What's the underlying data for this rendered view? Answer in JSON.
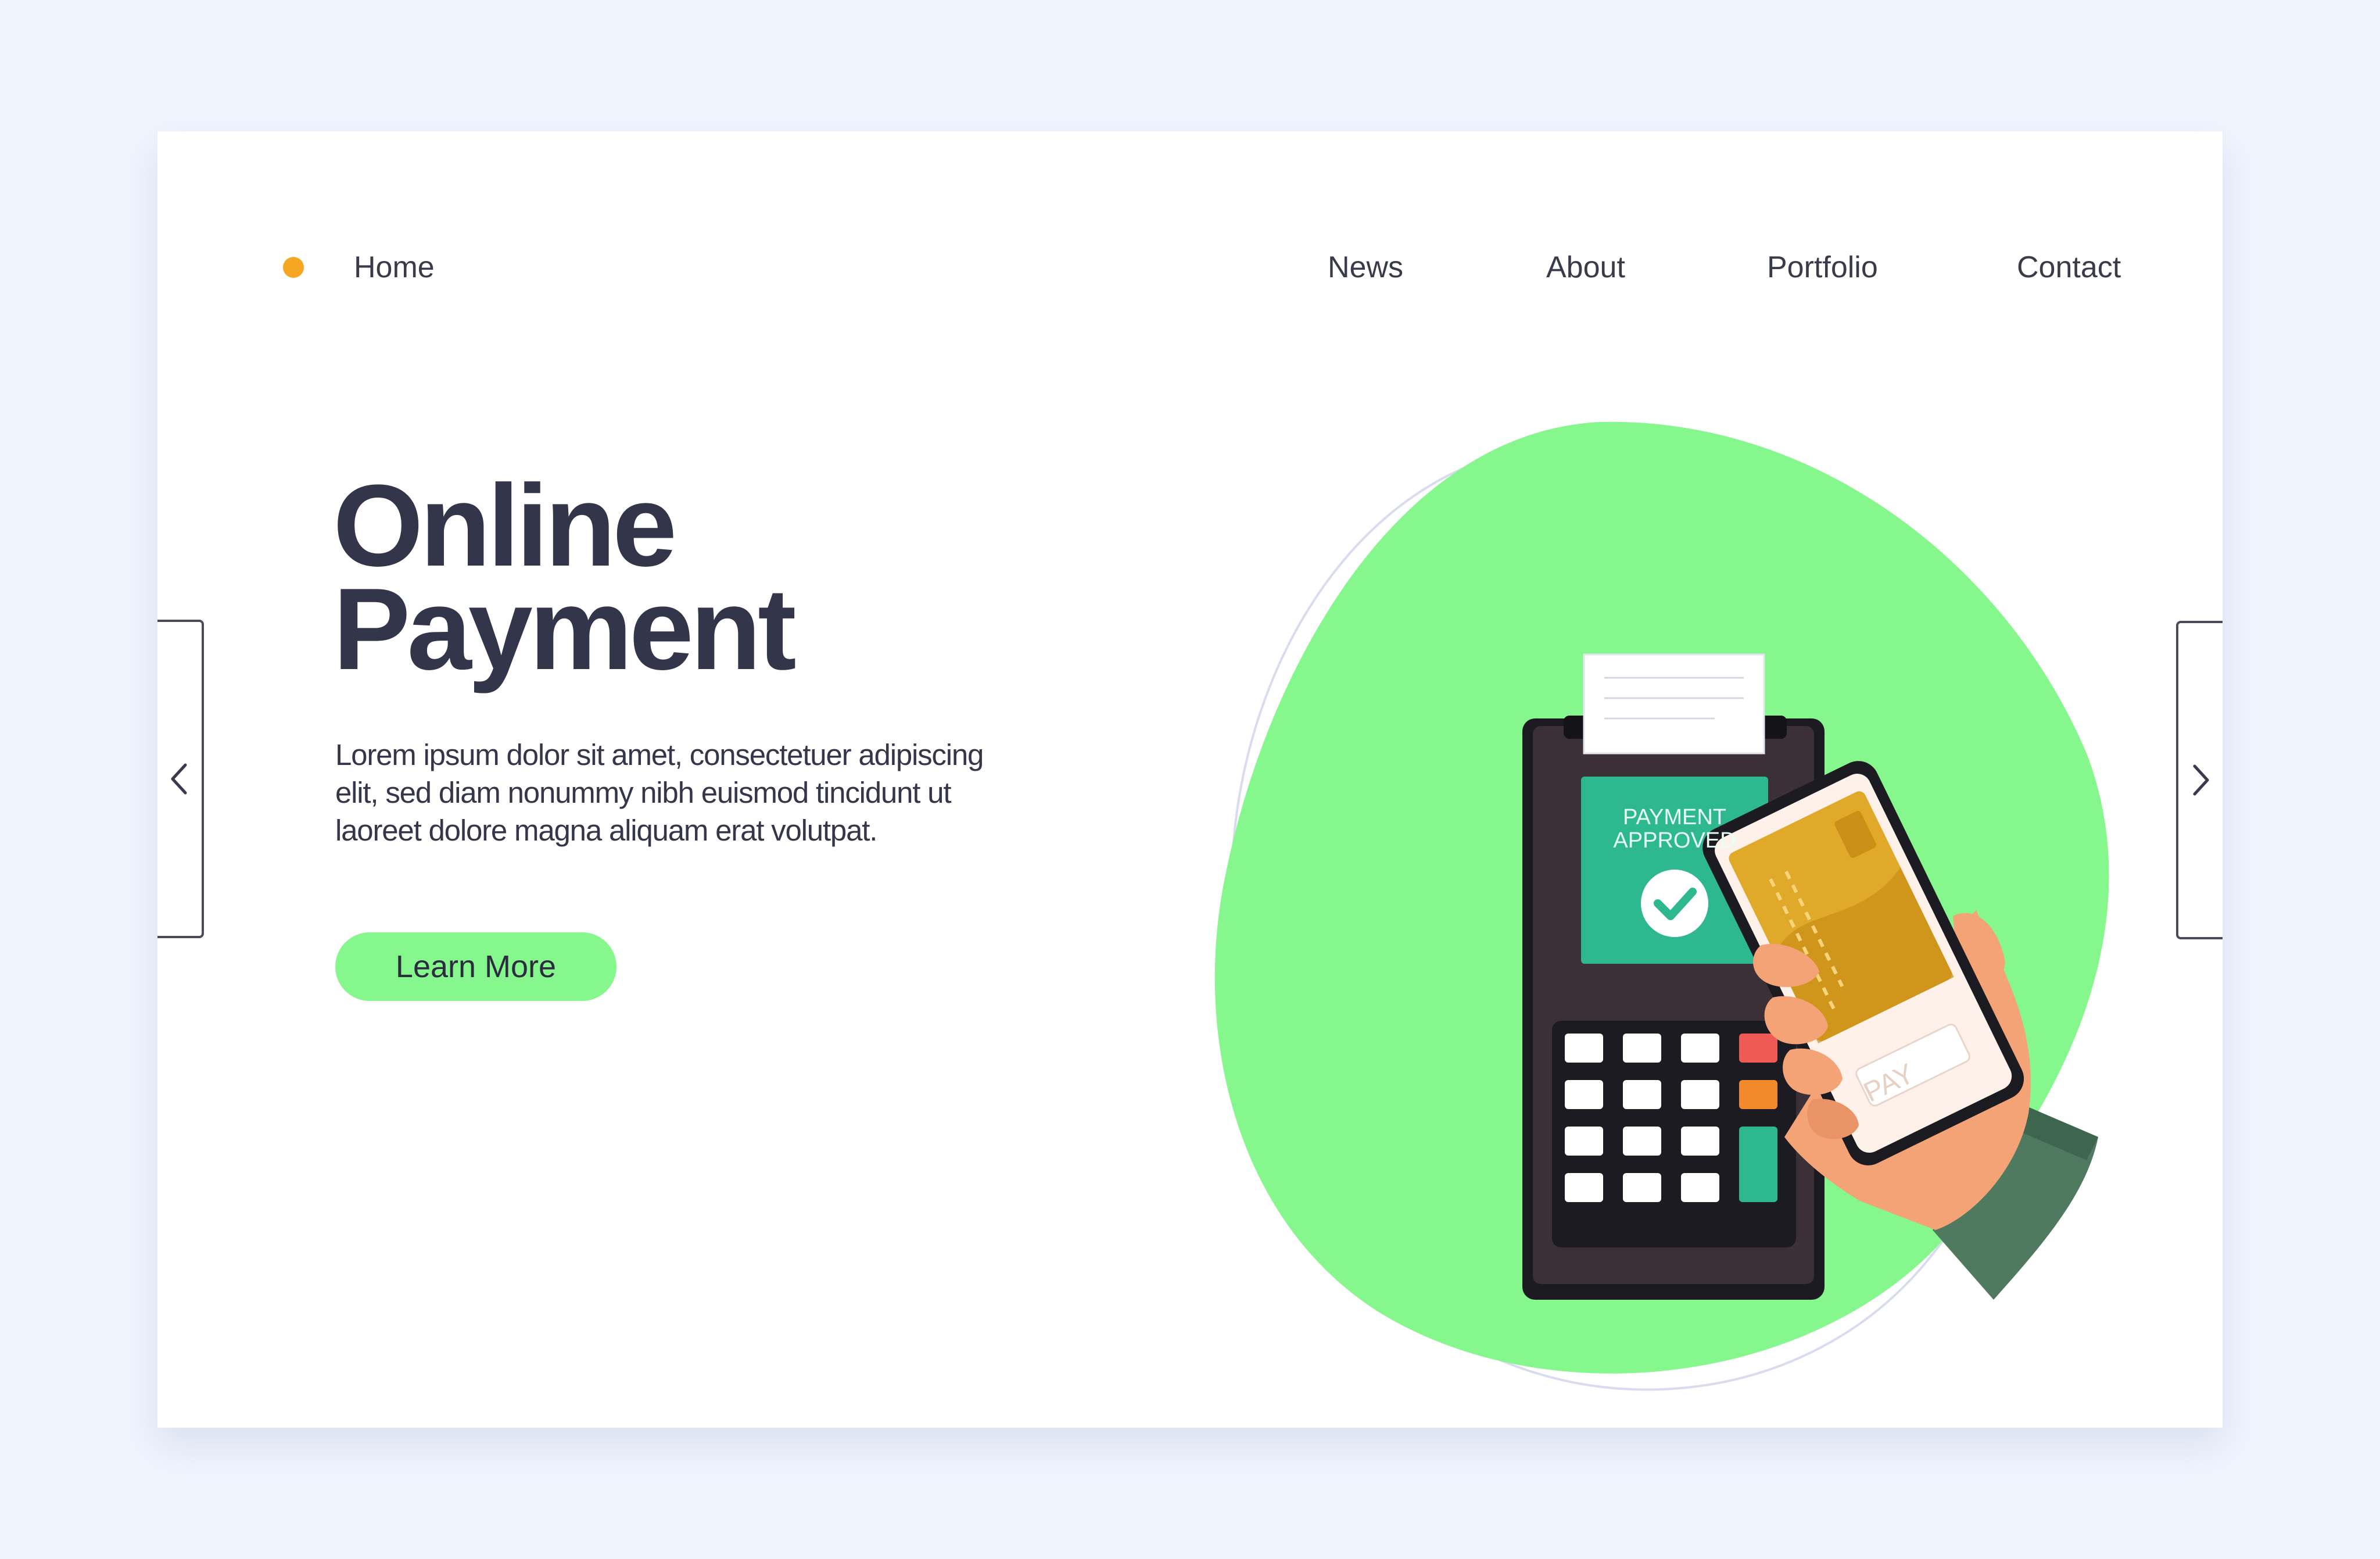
{
  "nav": {
    "home": "Home",
    "items": [
      "News",
      "About",
      "Portfolio",
      "Contact"
    ]
  },
  "hero": {
    "title": "Online\nPayment",
    "description": "Lorem ipsum dolor sit amet, consectetuer adipiscing elit, sed diam nonummy nibh euismod tincidunt ut laoreet dolore magna aliquam erat volutpat.",
    "cta_label": "Learn More"
  },
  "illustration": {
    "terminal_screen_text": "PAYMENT\nAPPROVED",
    "phone_button_text": "PAY"
  },
  "colors": {
    "accent_dot": "#f5a623",
    "cta_green": "#86f78c",
    "blob_green": "#86f78c",
    "title_dark": "#33354a",
    "terminal_screen": "#2eb890"
  },
  "icons": {
    "prev": "chevron-left-icon",
    "next": "chevron-right-icon",
    "check": "check-circle-icon"
  }
}
